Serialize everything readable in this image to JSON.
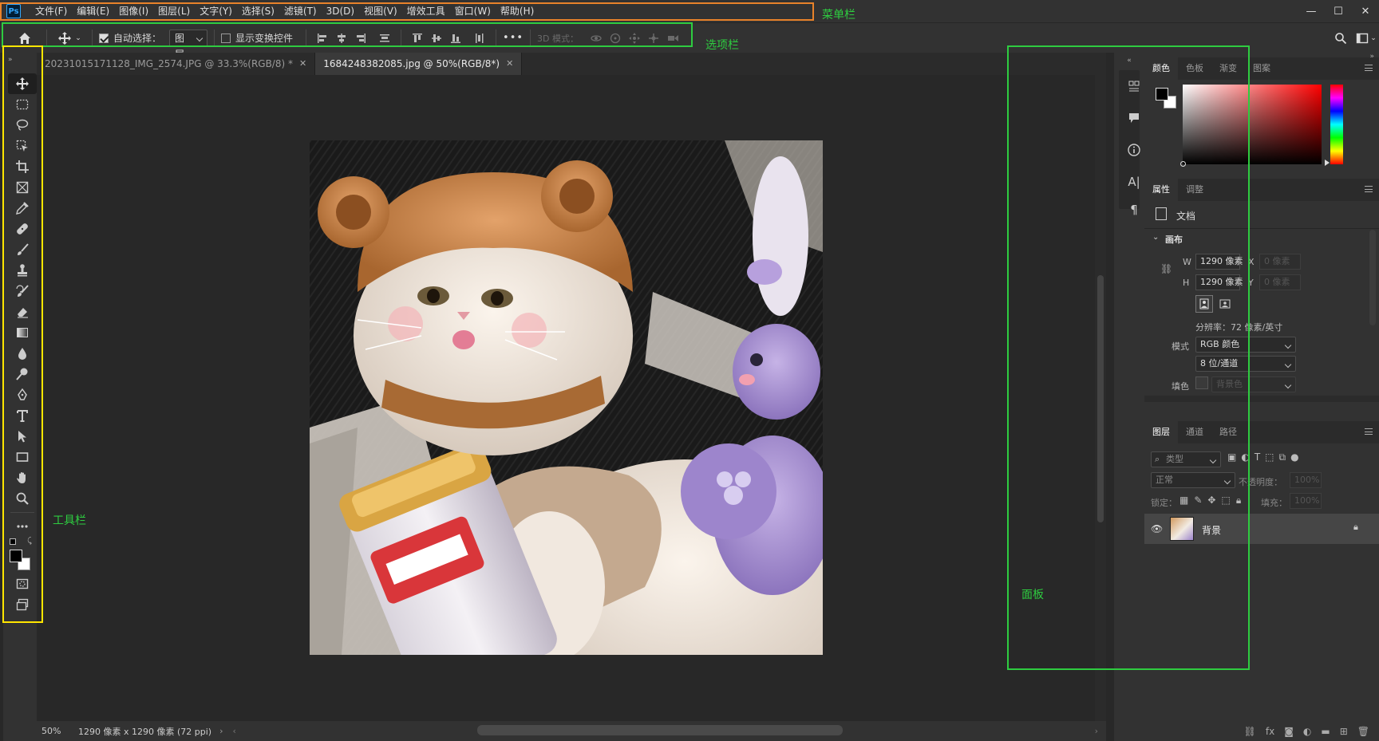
{
  "app": {
    "logo": "Ps",
    "accent": "#31a8ff"
  },
  "menu": [
    "文件(F)",
    "编辑(E)",
    "图像(I)",
    "图层(L)",
    "文字(Y)",
    "选择(S)",
    "滤镜(T)",
    "3D(D)",
    "视图(V)",
    "增效工具",
    "窗口(W)",
    "帮助(H)"
  ],
  "window_controls": {
    "minimize": "—",
    "maximize": "☐",
    "close": "✕"
  },
  "options": {
    "auto_select_label": "自动选择：",
    "auto_select_value": "图层",
    "auto_select_checked": true,
    "show_transform_label": "显示变换控件",
    "more": "•••",
    "mode_3d_label": "3D 模式："
  },
  "tabs": [
    {
      "label": "20231015171128_IMG_2574.JPG @ 33.3%(RGB/8) *",
      "active": false
    },
    {
      "label": "1684248382085.jpg @ 50%(RGB/8*)",
      "active": true
    }
  ],
  "status": {
    "zoom": "50%",
    "info": "1290 像素 x 1290 像素 (72 ppi)"
  },
  "color_panel": {
    "tabs": [
      "颜色",
      "色板",
      "渐变",
      "图案"
    ],
    "foreground": "#000000",
    "background": "#ffffff",
    "hue": "#ff0000"
  },
  "properties": {
    "tabs": [
      "属性",
      "调整"
    ],
    "doc_label": "文档",
    "section": "画布",
    "w_label": "W",
    "w_value": "1290 像素",
    "h_label": "H",
    "h_value": "1290 像素",
    "x_label": "X",
    "x_value": "0 像素",
    "y_label": "Y",
    "y_value": "0 像素",
    "resolution": "分辨率：72 像素/英寸",
    "mode_label": "模式",
    "mode_value": "RGB 颜色",
    "depth_value": "8 位/通道",
    "fill_label": "填色",
    "fill_value": "背景色"
  },
  "layers": {
    "tabs": [
      "图层",
      "通道",
      "路径"
    ],
    "filter_placeholder": "类型",
    "blend_mode": "正常",
    "opacity_label": "不透明度：",
    "opacity_value": "100%",
    "lock_label": "锁定：",
    "fill_label": "填充：",
    "fill_value": "100%",
    "items": [
      {
        "name": "背景",
        "visible": true,
        "locked": true
      }
    ]
  },
  "annotations": {
    "menubar": "菜单栏",
    "optionsbar": "选项栏",
    "toolbar": "工具栏",
    "panel": "面板",
    "color_orange": "#e8822a",
    "color_green": "#2ecc40",
    "color_yellow": "#ffe600"
  }
}
